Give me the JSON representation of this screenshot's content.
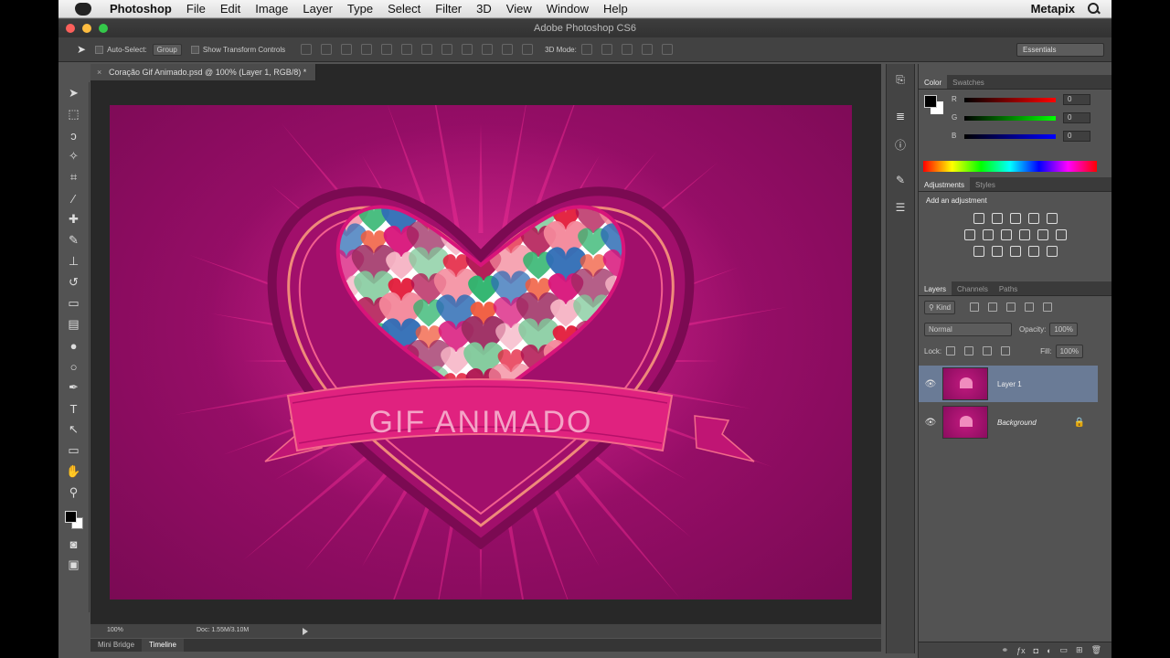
{
  "menubar": {
    "app_name": "Photoshop",
    "items": [
      "File",
      "Edit",
      "Image",
      "Layer",
      "Type",
      "Select",
      "Filter",
      "3D",
      "View",
      "Window",
      "Help"
    ],
    "user": "Metapix"
  },
  "window": {
    "title": "Adobe Photoshop CS6"
  },
  "options_bar": {
    "auto_select_label": "Auto-Select:",
    "auto_select_value": "Group",
    "show_transform_label": "Show Transform Controls",
    "mode_3d_label": "3D Mode:",
    "workspace": "Essentials"
  },
  "document": {
    "tab_title": "Coração Gif Animado.psd @ 100% (Layer 1, RGB/8) *",
    "zoom": "100%",
    "doc_size": "Doc: 1.55M/3.10M",
    "banner_text": "GIF ANIMADO"
  },
  "bottom_tabs": [
    "Mini Bridge",
    "Timeline"
  ],
  "colors": {
    "canvas_bg": "#9c0f6b",
    "accent": "#e8227e",
    "heart_border": "#f35a82"
  },
  "color_panel": {
    "tabs": [
      "Color",
      "Swatches"
    ],
    "channels": [
      {
        "label": "R",
        "value": "0"
      },
      {
        "label": "G",
        "value": "0"
      },
      {
        "label": "B",
        "value": "0"
      }
    ]
  },
  "adjustments_panel": {
    "tabs": [
      "Adjustments",
      "Styles"
    ],
    "title": "Add an adjustment"
  },
  "layers_panel": {
    "tabs": [
      "Layers",
      "Channels",
      "Paths"
    ],
    "kind_label": "Kind",
    "blend_mode": "Normal",
    "opacity_label": "Opacity:",
    "opacity_value": "100%",
    "lock_label": "Lock:",
    "fill_label": "Fill:",
    "fill_value": "100%",
    "layers": [
      {
        "name": "Layer 1",
        "selected": true
      },
      {
        "name": "Background",
        "selected": false,
        "locked": true
      }
    ]
  }
}
